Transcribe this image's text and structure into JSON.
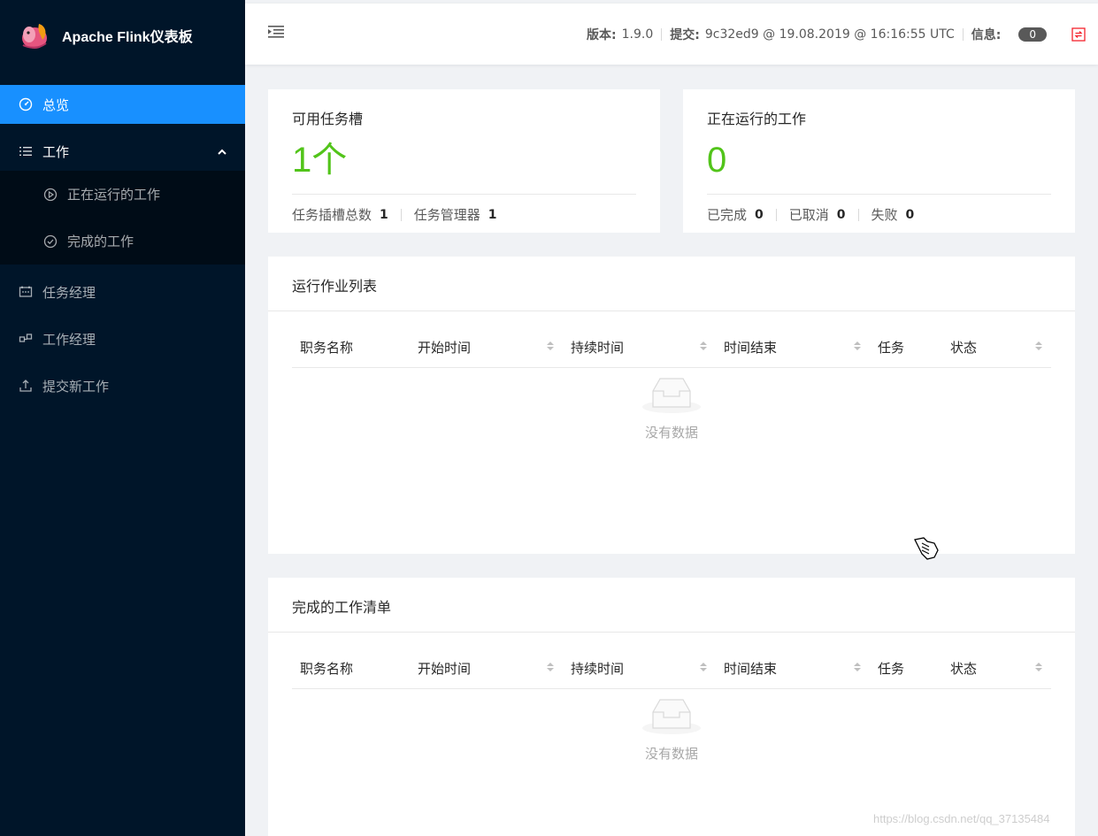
{
  "app": {
    "title": "Apache Flink仪表板"
  },
  "sidebar": {
    "items": [
      {
        "label": "总览",
        "icon": "dashboard-icon"
      },
      {
        "label": "工作",
        "icon": "list-icon"
      },
      {
        "label": "正在运行的工作",
        "icon": "play-circle-icon"
      },
      {
        "label": "完成的工作",
        "icon": "check-circle-icon"
      },
      {
        "label": "任务经理",
        "icon": "schedule-icon"
      },
      {
        "label": "工作经理",
        "icon": "cluster-icon"
      },
      {
        "label": "提交新工作",
        "icon": "upload-icon"
      }
    ]
  },
  "header": {
    "version_label": "版本:",
    "version_value": "1.9.0",
    "commit_label": "提交:",
    "commit_value": "9c32ed9 @ 19.08.2019 @ 16:16:55 UTC",
    "info_label": "信息:",
    "info_count": "0"
  },
  "slots_card": {
    "title": "可用任务槽",
    "value": "1个",
    "total_label": "任务插槽总数",
    "total_value": "1",
    "tm_label": "任务管理器",
    "tm_value": "1"
  },
  "running_card": {
    "title": "正在运行的工作",
    "value": "0",
    "finished_label": "已完成",
    "finished_value": "0",
    "canceled_label": "已取消",
    "canceled_value": "0",
    "failed_label": "失败",
    "failed_value": "0"
  },
  "running_list": {
    "title": "运行作业列表",
    "columns": [
      "职务名称",
      "开始时间",
      "持续时间",
      "时间结束",
      "任务",
      "状态"
    ],
    "empty_text": "没有数据"
  },
  "completed_list": {
    "title": "完成的工作清单",
    "columns": [
      "职务名称",
      "开始时间",
      "持续时间",
      "时间结束",
      "任务",
      "状态"
    ],
    "empty_text": "没有数据"
  },
  "watermark": "https://blog.csdn.net/qq_37135484",
  "colors": {
    "sider": "#001529",
    "active": "#1890ff",
    "accent_green": "#52c41a",
    "sync_red": "#f5222d"
  }
}
